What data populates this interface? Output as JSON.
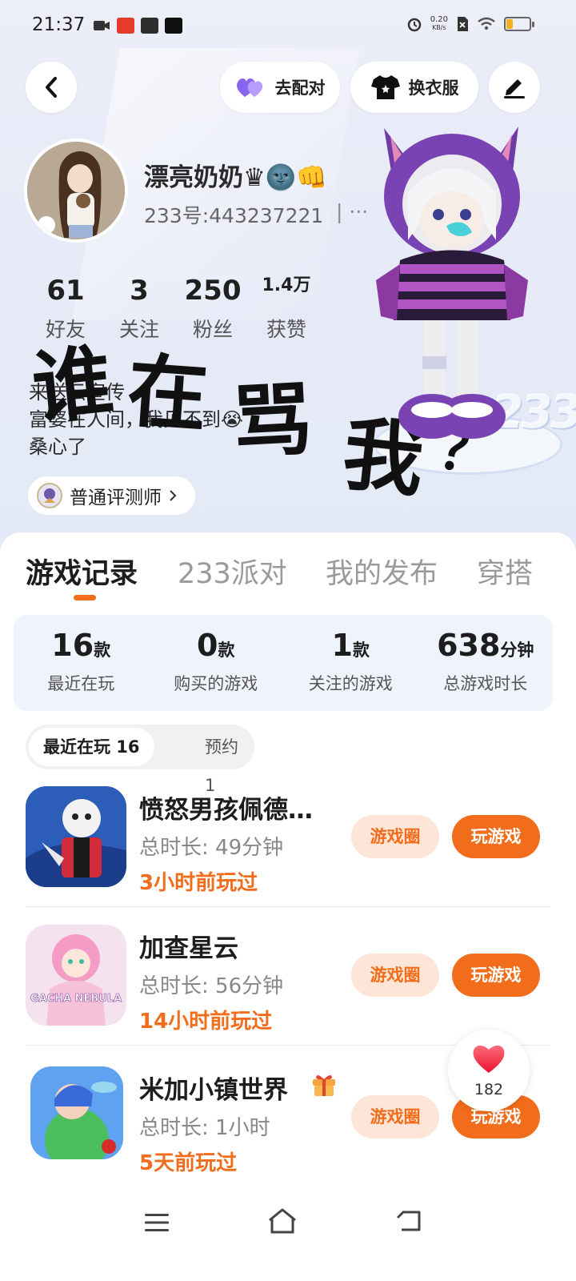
{
  "status_bar": {
    "time": "21:37",
    "net_speed_value": "0.20",
    "net_speed_unit": "KB/s",
    "battery_level": 0.25
  },
  "toolbar": {
    "match_label": "去配对",
    "dress_label": "换衣服"
  },
  "profile": {
    "nickname": "漂亮奶奶♛🌚👊",
    "uid": "233号:443237221",
    "uid_more": "| ···",
    "stats": [
      {
        "value": "61",
        "label": "好友"
      },
      {
        "value": "3",
        "label": "关注"
      },
      {
        "value": "250",
        "label": "粉丝"
      },
      {
        "value": "1.4万",
        "label": "获赞"
      }
    ],
    "bio_lines": [
      "来送云宣传",
      "富婆在人间，我见不到😭",
      "桑心了"
    ],
    "scribble": [
      "谁",
      "在",
      "骂",
      "我",
      "？"
    ],
    "tester_label": "普通评测师"
  },
  "tabs": [
    "游戏记录",
    "233派对",
    "我的发布",
    "穿搭"
  ],
  "summary": [
    {
      "num": "16",
      "unit": "款",
      "label": "最近在玩"
    },
    {
      "num": "0",
      "unit": "款",
      "label": "购买的游戏"
    },
    {
      "num": "1",
      "unit": "款",
      "label": "关注的游戏"
    },
    {
      "num": "638",
      "unit": "分钟",
      "label": "总游戏时长"
    }
  ],
  "filters": {
    "recent": "最近在玩 16",
    "reserve": "预约 1"
  },
  "games": [
    {
      "title": "愤怒男孩佩德…",
      "time": "总时长:  49分钟",
      "last": "3小时前玩过",
      "circle": "游戏圈",
      "play": "玩游戏"
    },
    {
      "title": "加查星云",
      "time": "总时长:  56分钟",
      "last": "14小时前玩过",
      "circle": "游戏圈",
      "play": "玩游戏"
    },
    {
      "title": "米加小镇世界",
      "time": "总时长:  1小时",
      "last": "5天前玩过",
      "circle": "游戏圈",
      "play": "玩游戏"
    }
  ],
  "game2_icon_text": "GACHA NEBULA",
  "like_count": "182",
  "colors": {
    "accent": "#f26d1b",
    "accent_soft": "#fde6d8",
    "panel": "#eff3fc"
  }
}
